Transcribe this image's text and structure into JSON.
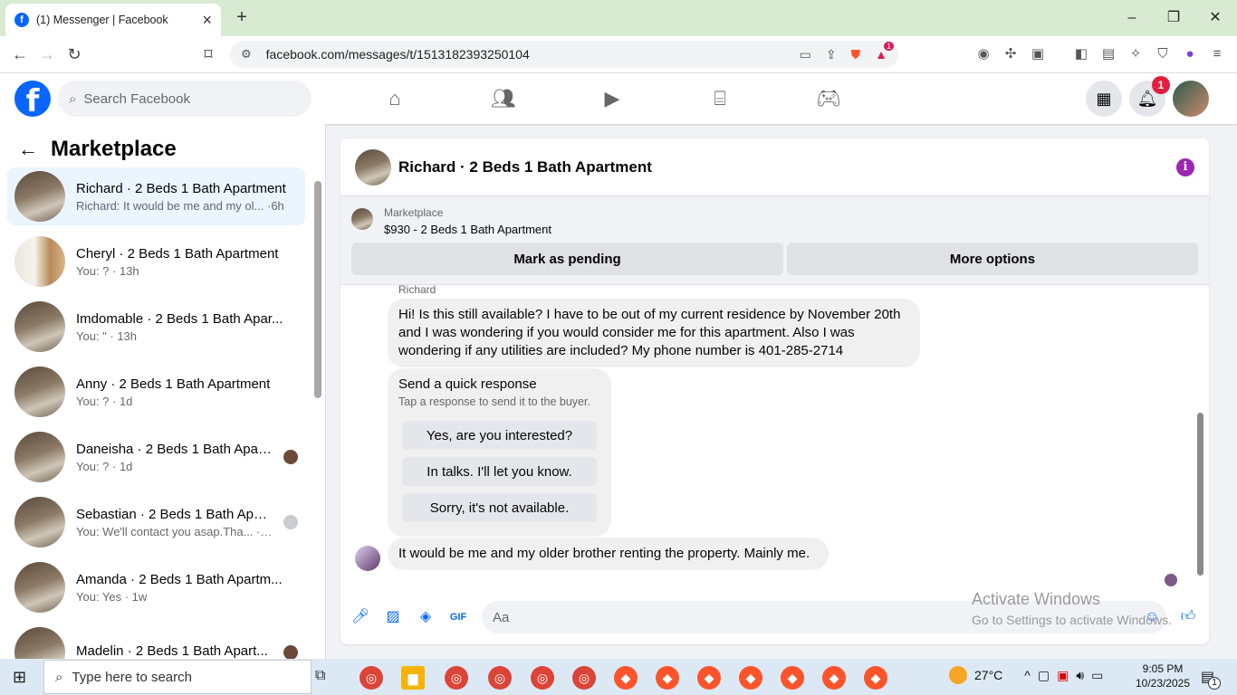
{
  "browser": {
    "tab_title": "(1) Messenger | Facebook",
    "url": "facebook.com/messages/t/1513182393250104",
    "extension_badge": "1"
  },
  "fb": {
    "search_placeholder": "Search Facebook",
    "notif_count": "1"
  },
  "left": {
    "title": "Marketplace",
    "conversations": [
      {
        "name": "Richard · 2 Beds 1 Bath Apartment",
        "preview": "Richard: It would be me and my ol... ·6h"
      },
      {
        "name": "Cheryl · 2 Beds 1 Bath Apartment",
        "preview": "You: ? · 13h"
      },
      {
        "name": "Imdomable · 2 Beds 1 Bath Apar...",
        "preview": "You: \" · 13h"
      },
      {
        "name": "Anny · 2 Beds 1 Bath Apartment",
        "preview": "You: ? · 1d"
      },
      {
        "name": "Daneisha · 2 Beds 1 Bath Apar...",
        "preview": "You: ? · 1d"
      },
      {
        "name": "Sebastian · 2 Beds 1 Bath Apar...",
        "preview": "You: We'll contact you asap.Tha... · 1d"
      },
      {
        "name": "Amanda · 2 Beds 1 Bath Apartm...",
        "preview": "You: Yes · 1w"
      },
      {
        "name": "Madelin · 2 Beds 1 Bath Apart...",
        "preview": ""
      }
    ]
  },
  "chat": {
    "title": "Richard · 2 Beds 1 Bath Apartment",
    "marketplace_label": "Marketplace",
    "item": "$930 - 2 Beds 1 Bath Apartment",
    "mark_pending": "Mark as pending",
    "more_options": "More options",
    "sender": "Richard",
    "message1": "Hi! Is this still available? I have to be out of my current residence by November 20th and I was wondering if you would consider me for this apartment. Also I was wondering if any utilities are included? My phone number is 401-285-2714",
    "quick_title": "Send a quick response",
    "quick_sub": "Tap a response to send it to the buyer.",
    "quick_options": [
      "Yes, are you interested?",
      "In talks. I'll let you know.",
      "Sorry, it's not available."
    ],
    "message2": "It would be me and my older brother renting the property. Mainly me.",
    "compose_placeholder": "Aa"
  },
  "watermark": {
    "line1": "Activate Windows",
    "line2": "Go to Settings to activate Windows."
  },
  "taskbar": {
    "search_placeholder": "Type here to search",
    "weather": "27°C",
    "time": "9:05 PM",
    "date": "10/23/2025",
    "notif": "1"
  }
}
